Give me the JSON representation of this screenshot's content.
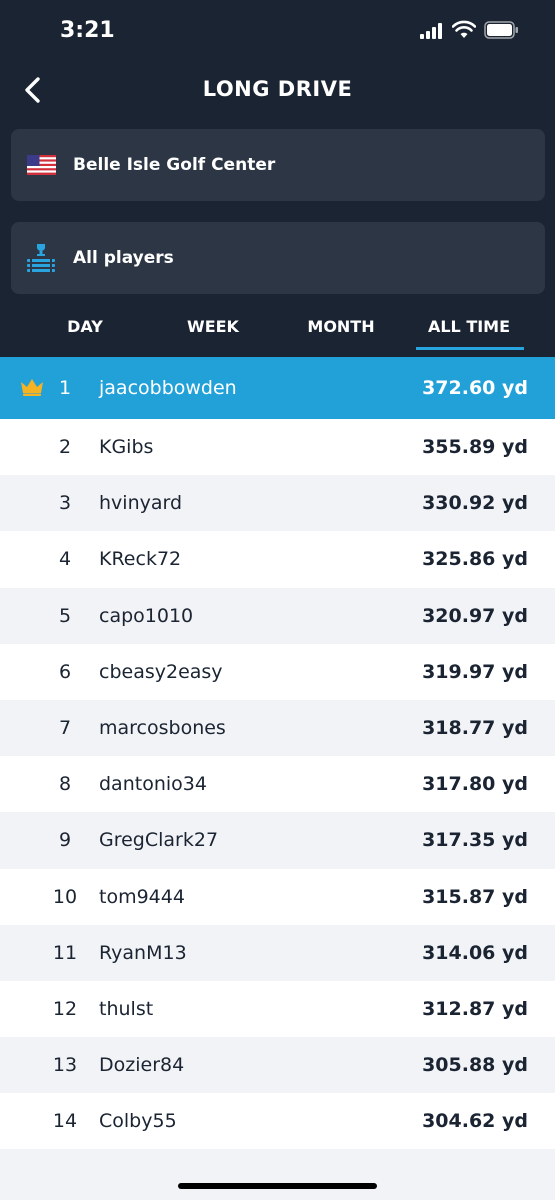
{
  "status_bar": {
    "time": "3:21"
  },
  "nav": {
    "title": "LONG DRIVE",
    "back_icon": "chevron-left-icon"
  },
  "location": {
    "label": "Belle Isle Golf Center",
    "icon": "us-flag-icon"
  },
  "players_filter": {
    "label": "All players",
    "icon": "trophy-podium-icon"
  },
  "tabs": [
    {
      "label": "DAY",
      "selected": false
    },
    {
      "label": "WEEK",
      "selected": false
    },
    {
      "label": "MONTH",
      "selected": false
    },
    {
      "label": "ALL TIME",
      "selected": true
    }
  ],
  "leaderboard": [
    {
      "rank": "1",
      "name": "jaacobbowden",
      "distance": "372.60 yd"
    },
    {
      "rank": "2",
      "name": "KGibs",
      "distance": "355.89 yd"
    },
    {
      "rank": "3",
      "name": "hvinyard",
      "distance": "330.92 yd"
    },
    {
      "rank": "4",
      "name": "KReck72",
      "distance": "325.86 yd"
    },
    {
      "rank": "5",
      "name": "capo1010",
      "distance": "320.97 yd"
    },
    {
      "rank": "6",
      "name": "cbeasy2easy",
      "distance": "319.97 yd"
    },
    {
      "rank": "7",
      "name": "marcosbones",
      "distance": "318.77 yd"
    },
    {
      "rank": "8",
      "name": "dantonio34",
      "distance": "317.80 yd"
    },
    {
      "rank": "9",
      "name": "GregClark27",
      "distance": "317.35 yd"
    },
    {
      "rank": "10",
      "name": "tom9444",
      "distance": "315.87 yd"
    },
    {
      "rank": "11",
      "name": "RyanM13",
      "distance": "314.06 yd"
    },
    {
      "rank": "12",
      "name": "thulst",
      "distance": "312.87 yd"
    },
    {
      "rank": "13",
      "name": "Dozier84",
      "distance": "305.88 yd"
    },
    {
      "rank": "14",
      "name": "Colby55",
      "distance": "304.62 yd"
    },
    {
      "rank": "",
      "name": "",
      "distance": ""
    }
  ],
  "colors": {
    "header_bg": "#1b2432",
    "card_bg": "#2c3645",
    "accent": "#22a1d9",
    "crown": "#f5b323",
    "row_alt": "#f2f3f6"
  }
}
